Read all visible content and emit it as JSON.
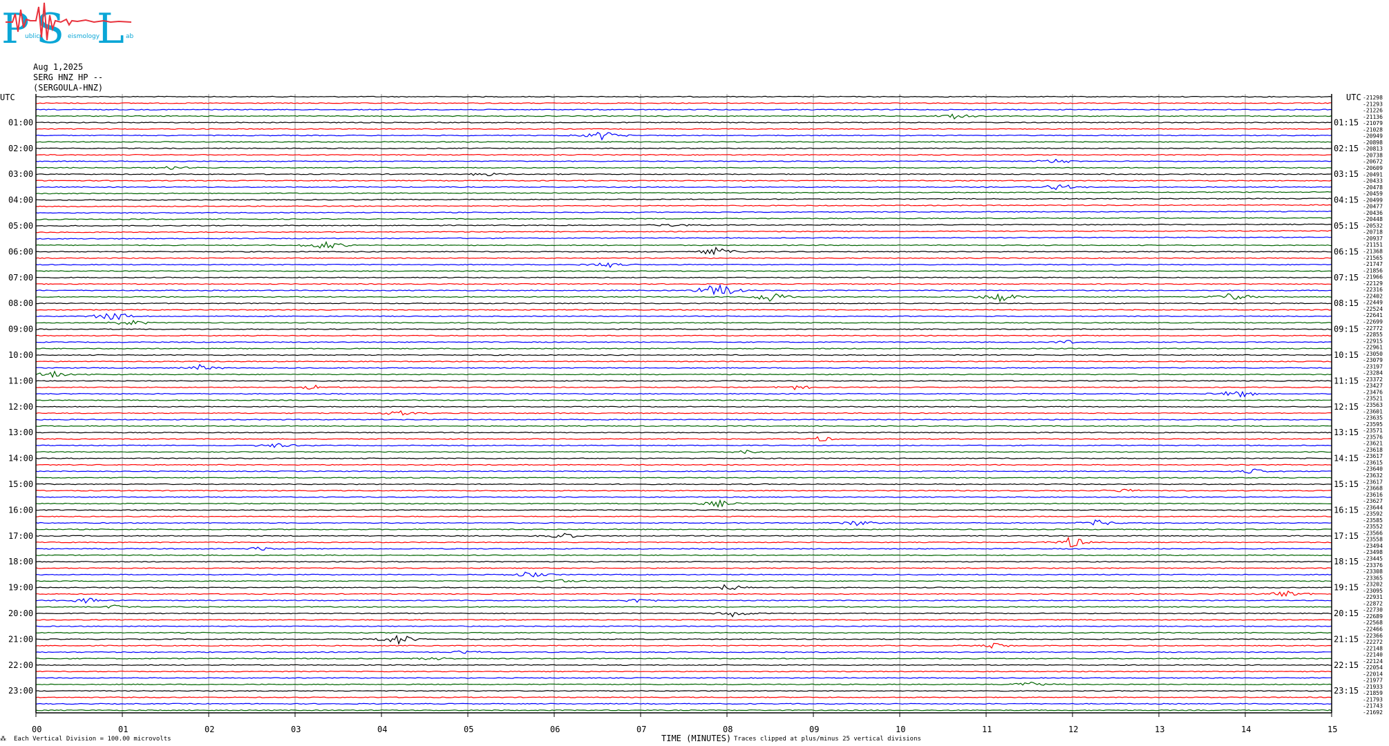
{
  "logo": {
    "letters": [
      "P",
      "S",
      "L"
    ],
    "small_words": [
      "ublic",
      "eismology",
      "ab"
    ],
    "colors": {
      "letters": "#0aa6d6",
      "wave": "#e8323c"
    }
  },
  "header": {
    "date": "Aug 1,2025",
    "station": "SERG HNZ HP --",
    "network": "(SERGOULA-HNZ)"
  },
  "left_utc_label": "UTC",
  "right_utc_label": "UTC",
  "footer": {
    "vertical_division": "Each Vertical Division =  100.00 microvolts",
    "x_title": "TIME (MINUTES)",
    "clip_note": "Traces clipped at plus/minus 25 vertical divisions",
    "corner_mark": "⁂"
  },
  "chart_data": {
    "type": "line",
    "subtype": "helicorder",
    "xlabel": "TIME (MINUTES)",
    "xlim": [
      0,
      15
    ],
    "x_ticks": [
      "00",
      "01",
      "02",
      "03",
      "04",
      "05",
      "06",
      "07",
      "08",
      "09",
      "10",
      "11",
      "12",
      "13",
      "14",
      "15"
    ],
    "rows_per_hour": 4,
    "total_rows": 96,
    "trace_colors": [
      "#000000",
      "#ff0000",
      "#0000ff",
      "#006400"
    ],
    "gridlines_vertical": true,
    "left_hour_labels": [
      "01:00",
      "02:00",
      "03:00",
      "04:00",
      "05:00",
      "06:00",
      "07:00",
      "08:00",
      "09:00",
      "10:00",
      "11:00",
      "12:00",
      "13:00",
      "14:00",
      "15:00",
      "16:00",
      "17:00",
      "18:00",
      "19:00",
      "20:00",
      "21:00",
      "22:00",
      "23:00"
    ],
    "right_hour_labels": [
      "01:15",
      "02:15",
      "03:15",
      "04:15",
      "05:15",
      "06:15",
      "07:15",
      "08:15",
      "09:15",
      "10:15",
      "11:15",
      "12:15",
      "13:15",
      "14:15",
      "15:15",
      "16:15",
      "17:15",
      "18:15",
      "19:15",
      "20:15",
      "21:15",
      "22:15",
      "23:15"
    ],
    "right_offsets": [
      "-21298",
      "-21293",
      "-21226",
      "-21136",
      "-21079",
      "-21028",
      "-20949",
      "-20898",
      "-20813",
      "-20738",
      "-20672",
      "-20609",
      "-20491",
      "-20433",
      "-20478",
      "-20459",
      "-20499",
      "-20477",
      "-20436",
      "-20448",
      "-20532",
      "-20718",
      "-20937",
      "-21151",
      "-21368",
      "-21565",
      "-21747",
      "-21856",
      "-21966",
      "-22129",
      "-22316",
      "-22402",
      "-22449",
      "-22524",
      "-22641",
      "-22699",
      "-22772",
      "-22855",
      "-22915",
      "-22961",
      "-23050",
      "-23079",
      "-23197",
      "-23284",
      "-23372",
      "-23427",
      "-23476",
      "-23521",
      "-23563",
      "-23601",
      "-23635",
      "-23595",
      "-23571",
      "-23576",
      "-23621",
      "-23618",
      "-23617",
      "-23615",
      "-23640",
      "-23632",
      "-23617",
      "-23668",
      "-23616",
      "-23627",
      "-23644",
      "-23592",
      "-23585",
      "-23552",
      "-23566",
      "-23558",
      "-23494",
      "-23498",
      "-23445",
      "-23376",
      "-23308",
      "-23365",
      "-23202",
      "-23095",
      "-22931",
      "-22872",
      "-22730",
      "-22689",
      "-22568",
      "-22466",
      "-22366",
      "-22272",
      "-22148",
      "-22140",
      "-22124",
      "-22054",
      "-22014",
      "-21977",
      "-21933",
      "-21859",
      "-21793",
      "-21743",
      "-21692"
    ],
    "events": [
      {
        "row": 3,
        "minute": 10.65,
        "amp": 4
      },
      {
        "row": 6,
        "minute": 6.55,
        "amp": 7
      },
      {
        "row": 10,
        "minute": 11.8,
        "amp": 4
      },
      {
        "row": 11,
        "minute": 1.6,
        "amp": 3
      },
      {
        "row": 12,
        "minute": 5.2,
        "amp": 3
      },
      {
        "row": 14,
        "minute": 11.85,
        "amp": 5
      },
      {
        "row": 20,
        "minute": 7.4,
        "amp": 3
      },
      {
        "row": 23,
        "minute": 3.35,
        "amp": 7
      },
      {
        "row": 24,
        "minute": 7.88,
        "amp": 7
      },
      {
        "row": 26,
        "minute": 6.6,
        "amp": 5
      },
      {
        "row": 30,
        "minute": 7.9,
        "amp": 14
      },
      {
        "row": 31,
        "minute": 8.5,
        "amp": 9
      },
      {
        "row": 31,
        "minute": 11.15,
        "amp": 9
      },
      {
        "row": 31,
        "minute": 13.85,
        "amp": 7
      },
      {
        "row": 34,
        "minute": 0.9,
        "amp": 8
      },
      {
        "row": 35,
        "minute": 1.1,
        "amp": 5
      },
      {
        "row": 38,
        "minute": 11.95,
        "amp": 3
      },
      {
        "row": 42,
        "minute": 1.9,
        "amp": 5
      },
      {
        "row": 43,
        "minute": 0.2,
        "amp": 5
      },
      {
        "row": 45,
        "minute": 3.2,
        "amp": 4
      },
      {
        "row": 45,
        "minute": 8.8,
        "amp": 4
      },
      {
        "row": 46,
        "minute": 13.9,
        "amp": 7
      },
      {
        "row": 49,
        "minute": 4.2,
        "amp": 5
      },
      {
        "row": 53,
        "minute": 9.1,
        "amp": 4
      },
      {
        "row": 54,
        "minute": 2.8,
        "amp": 4
      },
      {
        "row": 55,
        "minute": 8.2,
        "amp": 3
      },
      {
        "row": 58,
        "minute": 14.1,
        "amp": 4
      },
      {
        "row": 61,
        "minute": 12.6,
        "amp": 3
      },
      {
        "row": 63,
        "minute": 7.9,
        "amp": 5
      },
      {
        "row": 66,
        "minute": 12.3,
        "amp": 5
      },
      {
        "row": 66,
        "minute": 9.5,
        "amp": 5
      },
      {
        "row": 68,
        "minute": 6.1,
        "amp": 5
      },
      {
        "row": 69,
        "minute": 12.0,
        "amp": 9
      },
      {
        "row": 70,
        "minute": 2.6,
        "amp": 4
      },
      {
        "row": 74,
        "minute": 5.7,
        "amp": 5
      },
      {
        "row": 75,
        "minute": 6.1,
        "amp": 3
      },
      {
        "row": 76,
        "minute": 8.0,
        "amp": 6
      },
      {
        "row": 77,
        "minute": 14.5,
        "amp": 5
      },
      {
        "row": 78,
        "minute": 0.6,
        "amp": 4
      },
      {
        "row": 78,
        "minute": 7.0,
        "amp": 5
      },
      {
        "row": 79,
        "minute": 0.9,
        "amp": 3
      },
      {
        "row": 80,
        "minute": 8.1,
        "amp": 6
      },
      {
        "row": 84,
        "minute": 4.2,
        "amp": 8
      },
      {
        "row": 85,
        "minute": 11.1,
        "amp": 4
      },
      {
        "row": 86,
        "minute": 5.0,
        "amp": 3
      },
      {
        "row": 87,
        "minute": 4.6,
        "amp": 3
      },
      {
        "row": 91,
        "minute": 11.5,
        "amp": 5
      }
    ]
  }
}
